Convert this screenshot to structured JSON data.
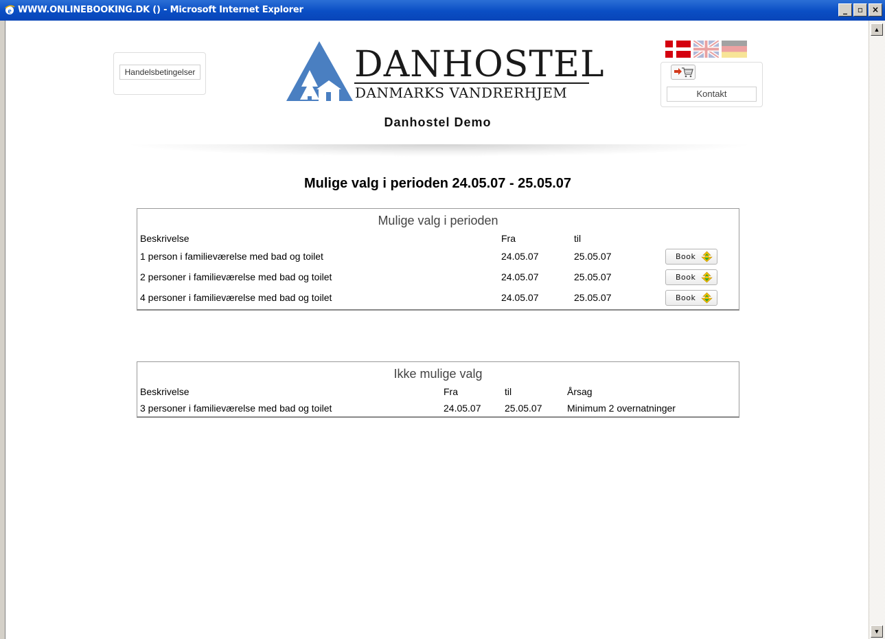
{
  "window": {
    "title": "WWW.ONLINEBOOKING.DK () - Microsoft Internet Explorer",
    "controls": [
      "_",
      "▫",
      "×"
    ]
  },
  "header": {
    "terms_button": "Handelsbetingelser",
    "logo_big": "DANHOSTEL",
    "logo_small": "DANMARKS VANDRERHJEM",
    "site_name": "Danhostel Demo",
    "contact_button": "Kontakt",
    "flags": [
      "danish-flag-icon",
      "uk-flag-icon",
      "german-flag-icon"
    ],
    "cart_icon": "shopping-cart-icon"
  },
  "page_heading": "Mulige valg i perioden 24.05.07 - 25.05.07",
  "available": {
    "title": "Mulige valg i perioden",
    "headers": {
      "description": "Beskrivelse",
      "from": "Fra",
      "to": "til"
    },
    "rows": [
      {
        "description": "1 person i familieværelse med bad og toilet",
        "from": "24.05.07",
        "to": "25.05.07",
        "action": "Book"
      },
      {
        "description": "2 personer i familieværelse med bad og toilet",
        "from": "24.05.07",
        "to": "25.05.07",
        "action": "Book"
      },
      {
        "description": "4 personer i familieværelse med bad og toilet",
        "from": "24.05.07",
        "to": "25.05.07",
        "action": "Book"
      }
    ]
  },
  "unavailable": {
    "title": "Ikke mulige valg",
    "headers": {
      "description": "Beskrivelse",
      "from": "Fra",
      "to": "til",
      "reason": "Årsag"
    },
    "rows": [
      {
        "description": "3 personer i familieværelse med bad og toilet",
        "from": "24.05.07",
        "to": "25.05.07",
        "reason": "Minimum 2 overnatninger"
      }
    ]
  },
  "colors": {
    "titlebar": "#0a4ec4",
    "logo_blue": "#4a7fc1",
    "book_arrow": "#f2c200"
  }
}
